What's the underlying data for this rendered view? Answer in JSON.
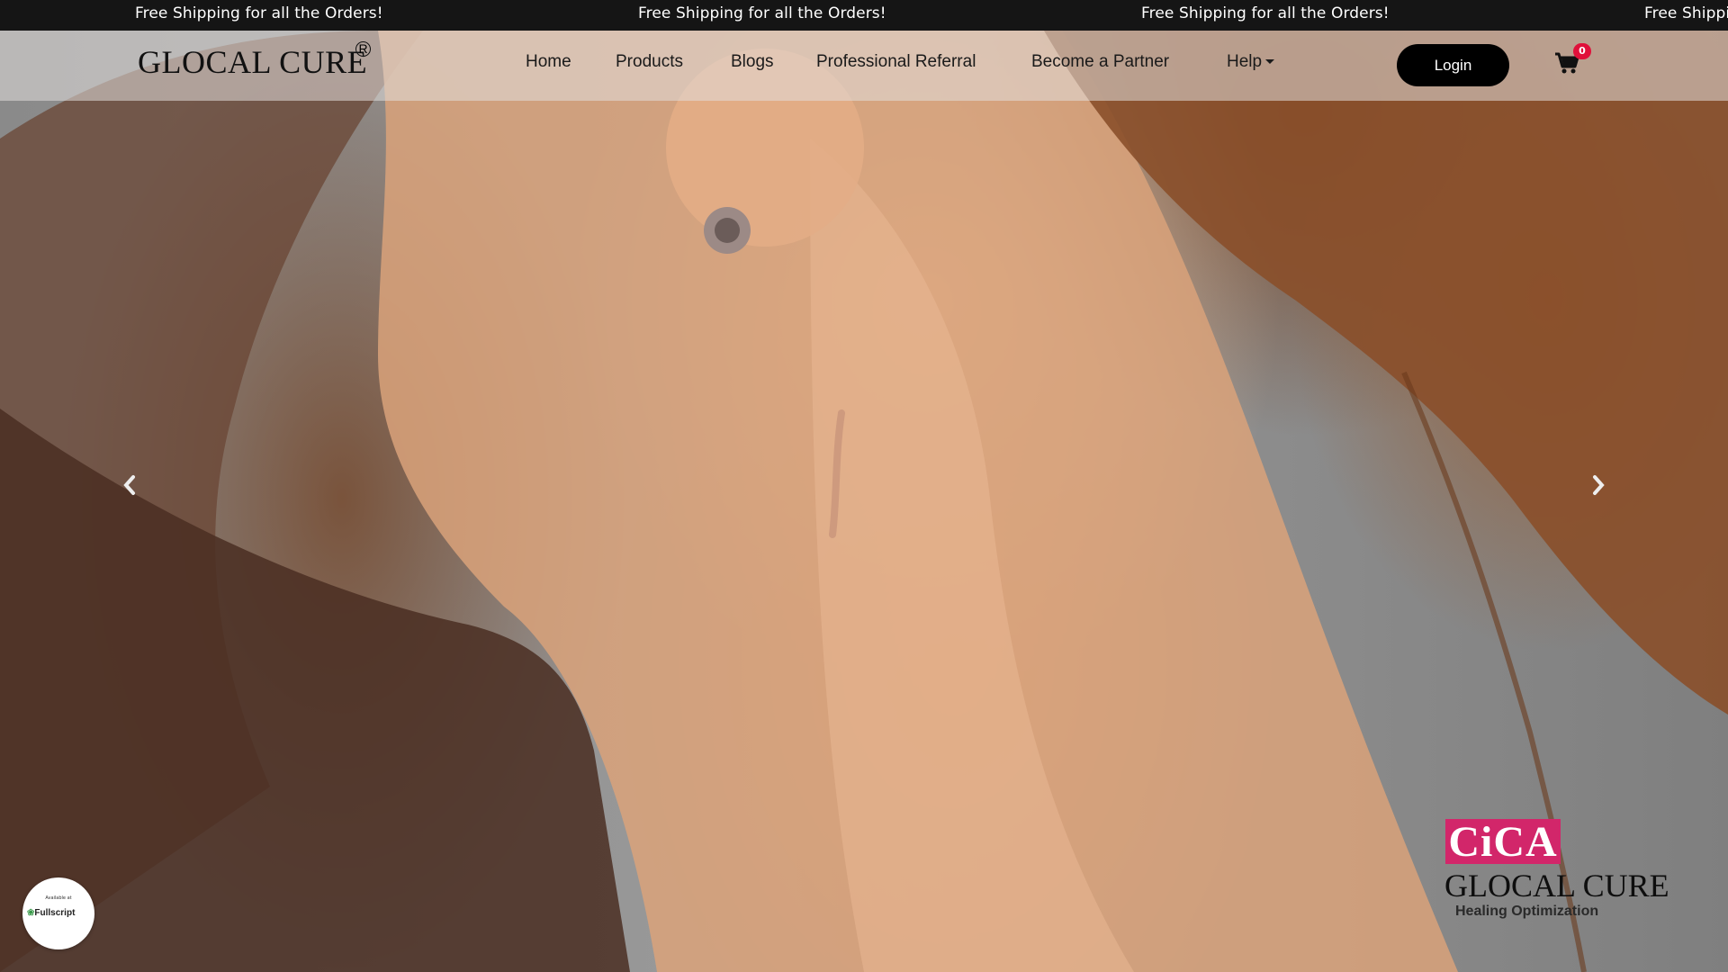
{
  "announcement": {
    "messages": [
      "Free Shipping for all the Orders!",
      "Free Shipping for all the Orders!",
      "Free Shipping for all the Orders!",
      "Free Shipping for all the Orders!"
    ]
  },
  "header": {
    "logo_text": "GLOCAL CURE",
    "logo_reg": "R",
    "nav": [
      "Home",
      "Products",
      "Blogs",
      "Professional Referral",
      "Become a Partner",
      "Help"
    ],
    "login_label": "Login",
    "cart_count": "0"
  },
  "hero": {
    "icons": {
      "prev": "chevron-left-icon",
      "next": "chevron-right-icon"
    },
    "brand_badge": "CiCA",
    "brand_name": "GLOCAL CURE",
    "brand_tagline": "Healing Optimization"
  },
  "fullscript": {
    "small_text": "Available at",
    "name": "Fullscript"
  },
  "colors": {
    "topbar": "#151515",
    "login_bg": "#000000",
    "cart_badge": "#e0103a",
    "cica_pink": "#d2266a"
  }
}
